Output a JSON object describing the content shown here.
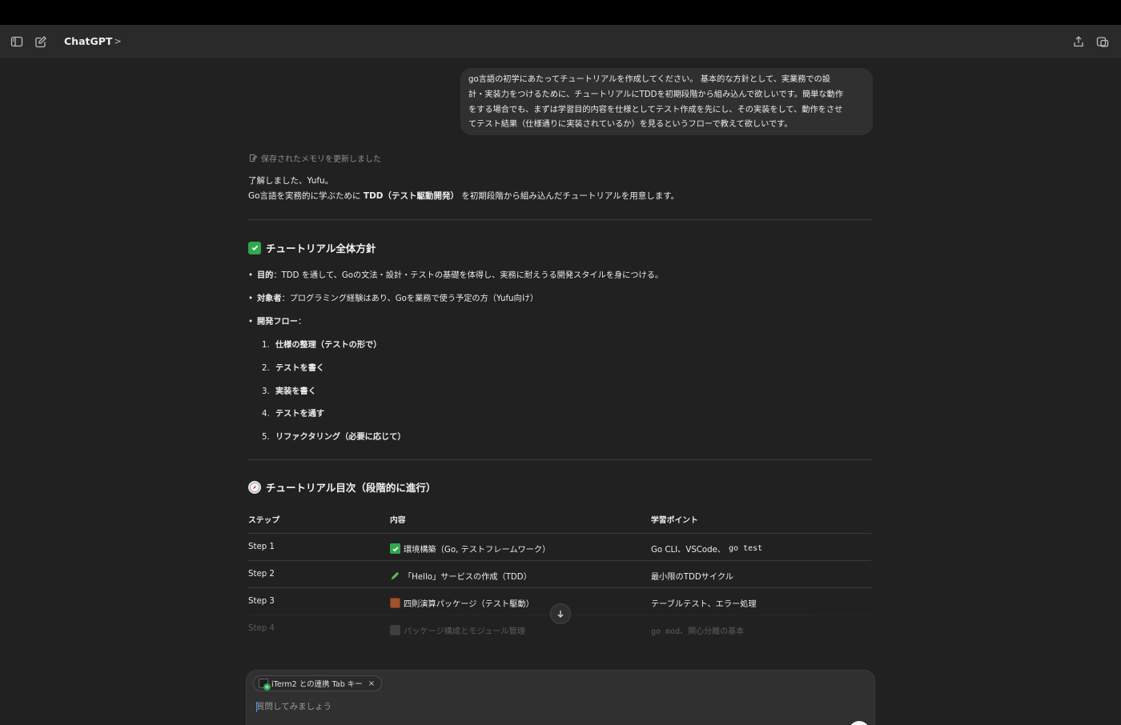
{
  "header": {
    "title": "ChatGPT",
    "title_chevron": ">"
  },
  "conversation": {
    "user_message_lines": [
      "go言語の初学にあたってチュートリアルを作成してください。 基本的な方針として、実業務での設",
      "計・実装力をつけるために、チュートリアルにTDDを初期段階から組み込んで欲しいです。簡単な動作",
      "をする場合でも、まずは学習目的内容を仕様としてテスト作成を先にし、その実装をして、動作をさせ",
      "てテスト結果（仕様通りに実装されているか）を見るというフローで教えて欲しいです。"
    ],
    "memory_notice": "保存されたメモリを更新しました",
    "reply_line1": "了解しました、Yufu。",
    "reply_line2_pre": "Go言語を実務的に学ぶために ",
    "reply_line2_bold": "TDD（テスト駆動開発）",
    "reply_line2_post": " を初期段階から組み込んだチュートリアルを用意します。",
    "section1_title": "チュートリアル全体方針",
    "section1_bullets": [
      {
        "label": "目的",
        "text": "：TDD を通して、Goの文法・設計・テストの基礎を体得し、実務に耐えうる開発スタイルを身につける。"
      },
      {
        "label": "対象者",
        "text": "：プログラミング経験はあり、Goを業務で使う予定の方（Yufu向け）"
      },
      {
        "label": "開発フロー",
        "text": "："
      }
    ],
    "flow_steps": [
      {
        "num": "1.",
        "text": "仕様の整理（テストの形で）"
      },
      {
        "num": "2.",
        "text": "テストを書く"
      },
      {
        "num": "3.",
        "text": "実装を書く"
      },
      {
        "num": "4.",
        "text": "テストを通す"
      },
      {
        "num": "5.",
        "text": "リファクタリング（必要に応じて）"
      }
    ],
    "section2_title": "チュートリアル目次（段階的に進行）",
    "table": {
      "headers": [
        "ステップ",
        "内容",
        "学習ポイント"
      ],
      "rows": [
        {
          "step": "Step 1",
          "icon": "check-mark-icon",
          "content": "環境構築（Go, テストフレームワーク）",
          "point_pre": "Go CLI、VSCode、",
          "point_code": "go test"
        },
        {
          "step": "Step 2",
          "icon": "pencil-icon",
          "content": "「Hello」サービスの作成（TDD）",
          "point_pre": "最小限のTDDサイクル",
          "point_code": ""
        },
        {
          "step": "Step 3",
          "icon": "abacus-icon",
          "content": "四則演算パッケージ（テスト駆動）",
          "point_pre": "テーブルテスト、エラー処理",
          "point_code": ""
        },
        {
          "step": "Step 4",
          "icon": "folder-icon",
          "content": "パッケージ構成とモジュール管理",
          "point_pre": "",
          "point_code": "go mod、関心分離の基本"
        }
      ]
    }
  },
  "composer": {
    "chip_label": "iTerm2 との連携 Tab キー",
    "chip_close": "×",
    "placeholder": "質問してみましょう"
  },
  "colors": {
    "background": "#212121",
    "header": "#2a2a2a",
    "bubble": "#303030",
    "accent_green": "#2fa84f"
  }
}
